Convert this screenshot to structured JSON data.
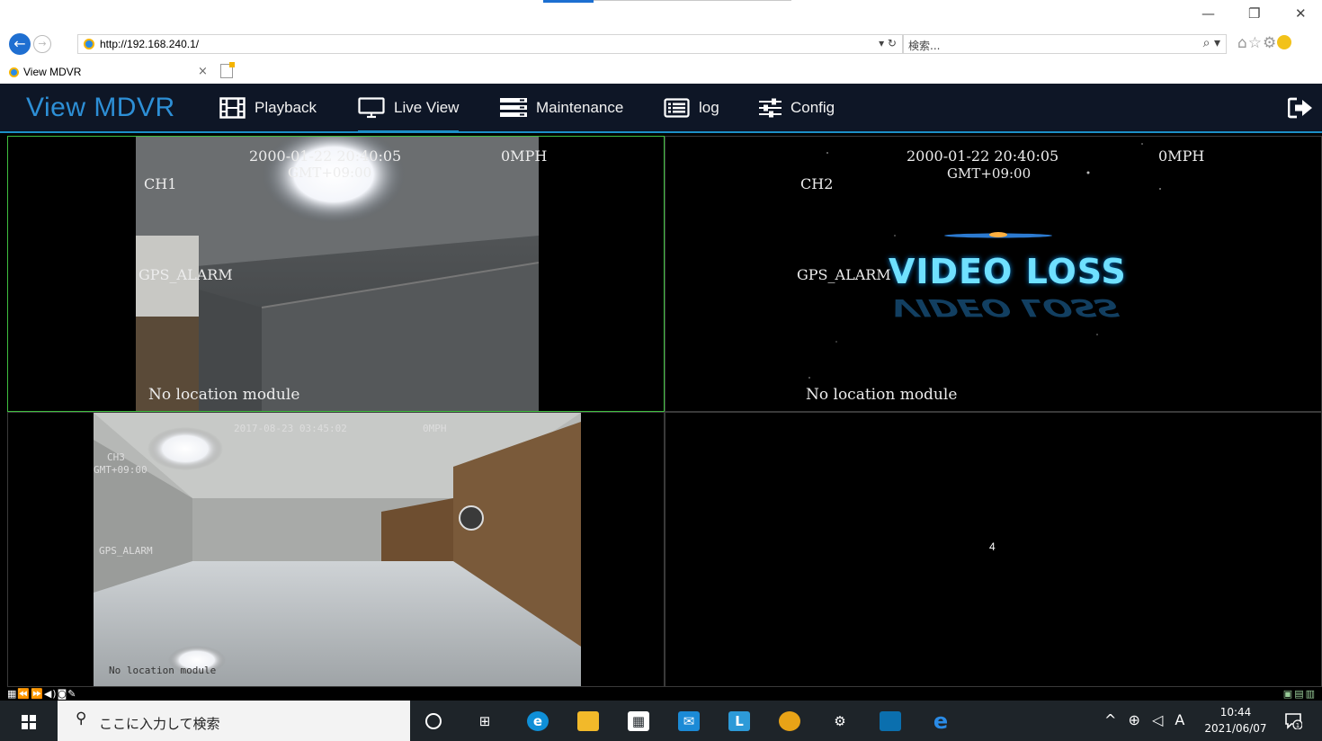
{
  "browser": {
    "window_controls": [
      "—",
      "❐",
      "✕"
    ],
    "address": "http://192.168.240.1/",
    "address_controls": "▾ ↻",
    "search_placeholder": "検索...",
    "search_controls": "⌕ ▾",
    "tab_title": "View MDVR",
    "tab_close": "×"
  },
  "app": {
    "brand": "View MDVR",
    "nav": [
      {
        "label": "Playback",
        "icon": "film-icon"
      },
      {
        "label": "Live View",
        "icon": "monitor-icon"
      },
      {
        "label": "Maintenance",
        "icon": "server-icon"
      },
      {
        "label": "log",
        "icon": "list-icon"
      },
      {
        "label": "Config",
        "icon": "sliders-icon"
      }
    ],
    "active_nav": "Live View",
    "accent_color": "#1c8fc7",
    "brand_color": "#2d8fd6"
  },
  "cameras": {
    "ch1": {
      "timestamp": "2000-01-22 20:40:05",
      "timezone": "GMT+09:00",
      "speed": "0MPH",
      "channel": "CH1",
      "alarm": "GPS_ALARM",
      "location": "No location module"
    },
    "ch2": {
      "timestamp": "2000-01-22 20:40:05",
      "timezone": "GMT+09:00",
      "speed": "0MPH",
      "channel": "CH2",
      "alarm": "GPS_ALARM",
      "status": "VIDEO LOSS",
      "location": "No location module"
    },
    "ch3": {
      "timestamp": "2017-08-23 03:45:02",
      "timezone": "GMT+09:00",
      "speed": "0MPH",
      "channel": "CH3",
      "alarm": "GPS_ALARM",
      "location": "No location module"
    },
    "ch4": {
      "label": "4"
    }
  },
  "taskbar": {
    "search_placeholder": "ここに入力して検索",
    "tray_icons": "^ ⊕ ◁ A",
    "time": "10:44",
    "date": "2021/06/07"
  }
}
